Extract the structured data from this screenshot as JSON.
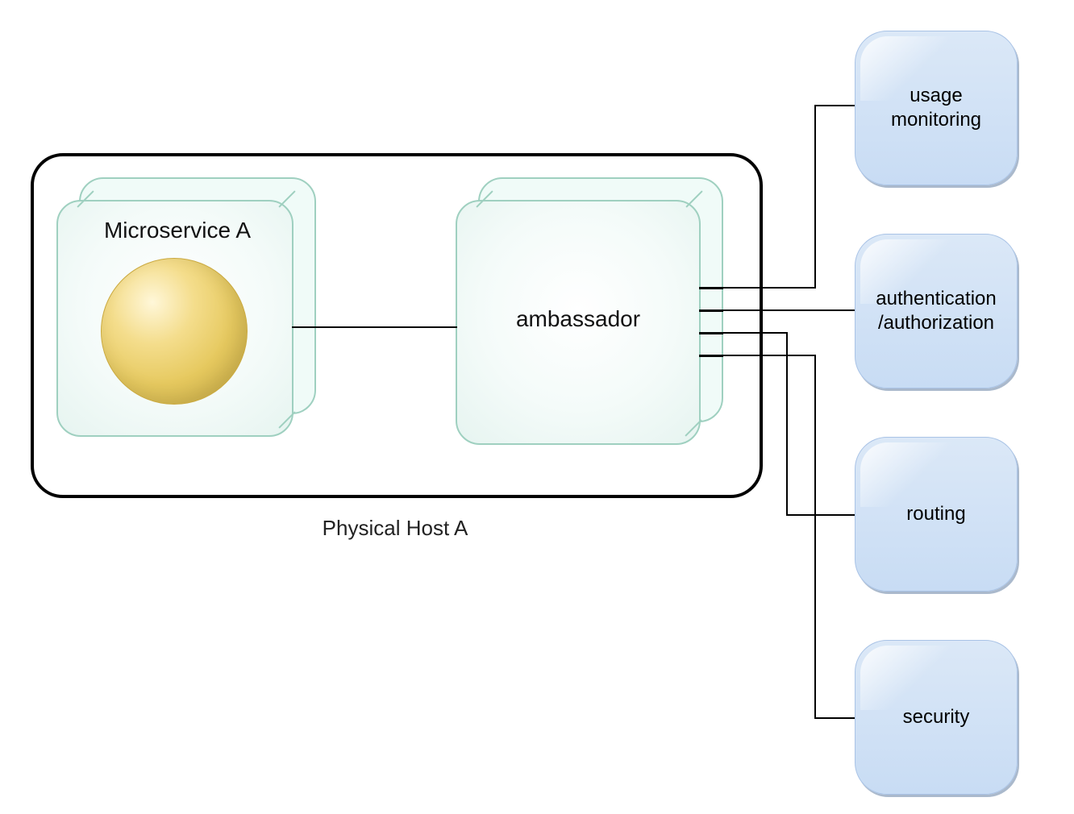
{
  "host": {
    "label": "Physical Host A",
    "microservice_label": "Microservice A",
    "ambassador_label": "ambassador"
  },
  "services": [
    {
      "label": "usage\nmonitoring"
    },
    {
      "label": "authentication\n/authorization"
    },
    {
      "label": "routing"
    },
    {
      "label": "security"
    }
  ],
  "colors": {
    "tile_bg_top": "#dbe8f7",
    "tile_bg_bottom": "#c8dcf4",
    "tile_border": "#a9c3e6",
    "cube_border": "#9fd0c0",
    "sphere": "#e6c95f",
    "line": "#000000"
  },
  "layout_note": "Ambassador pattern: microservice talks to ambassador sidecar on same host; ambassador fans out to external services."
}
